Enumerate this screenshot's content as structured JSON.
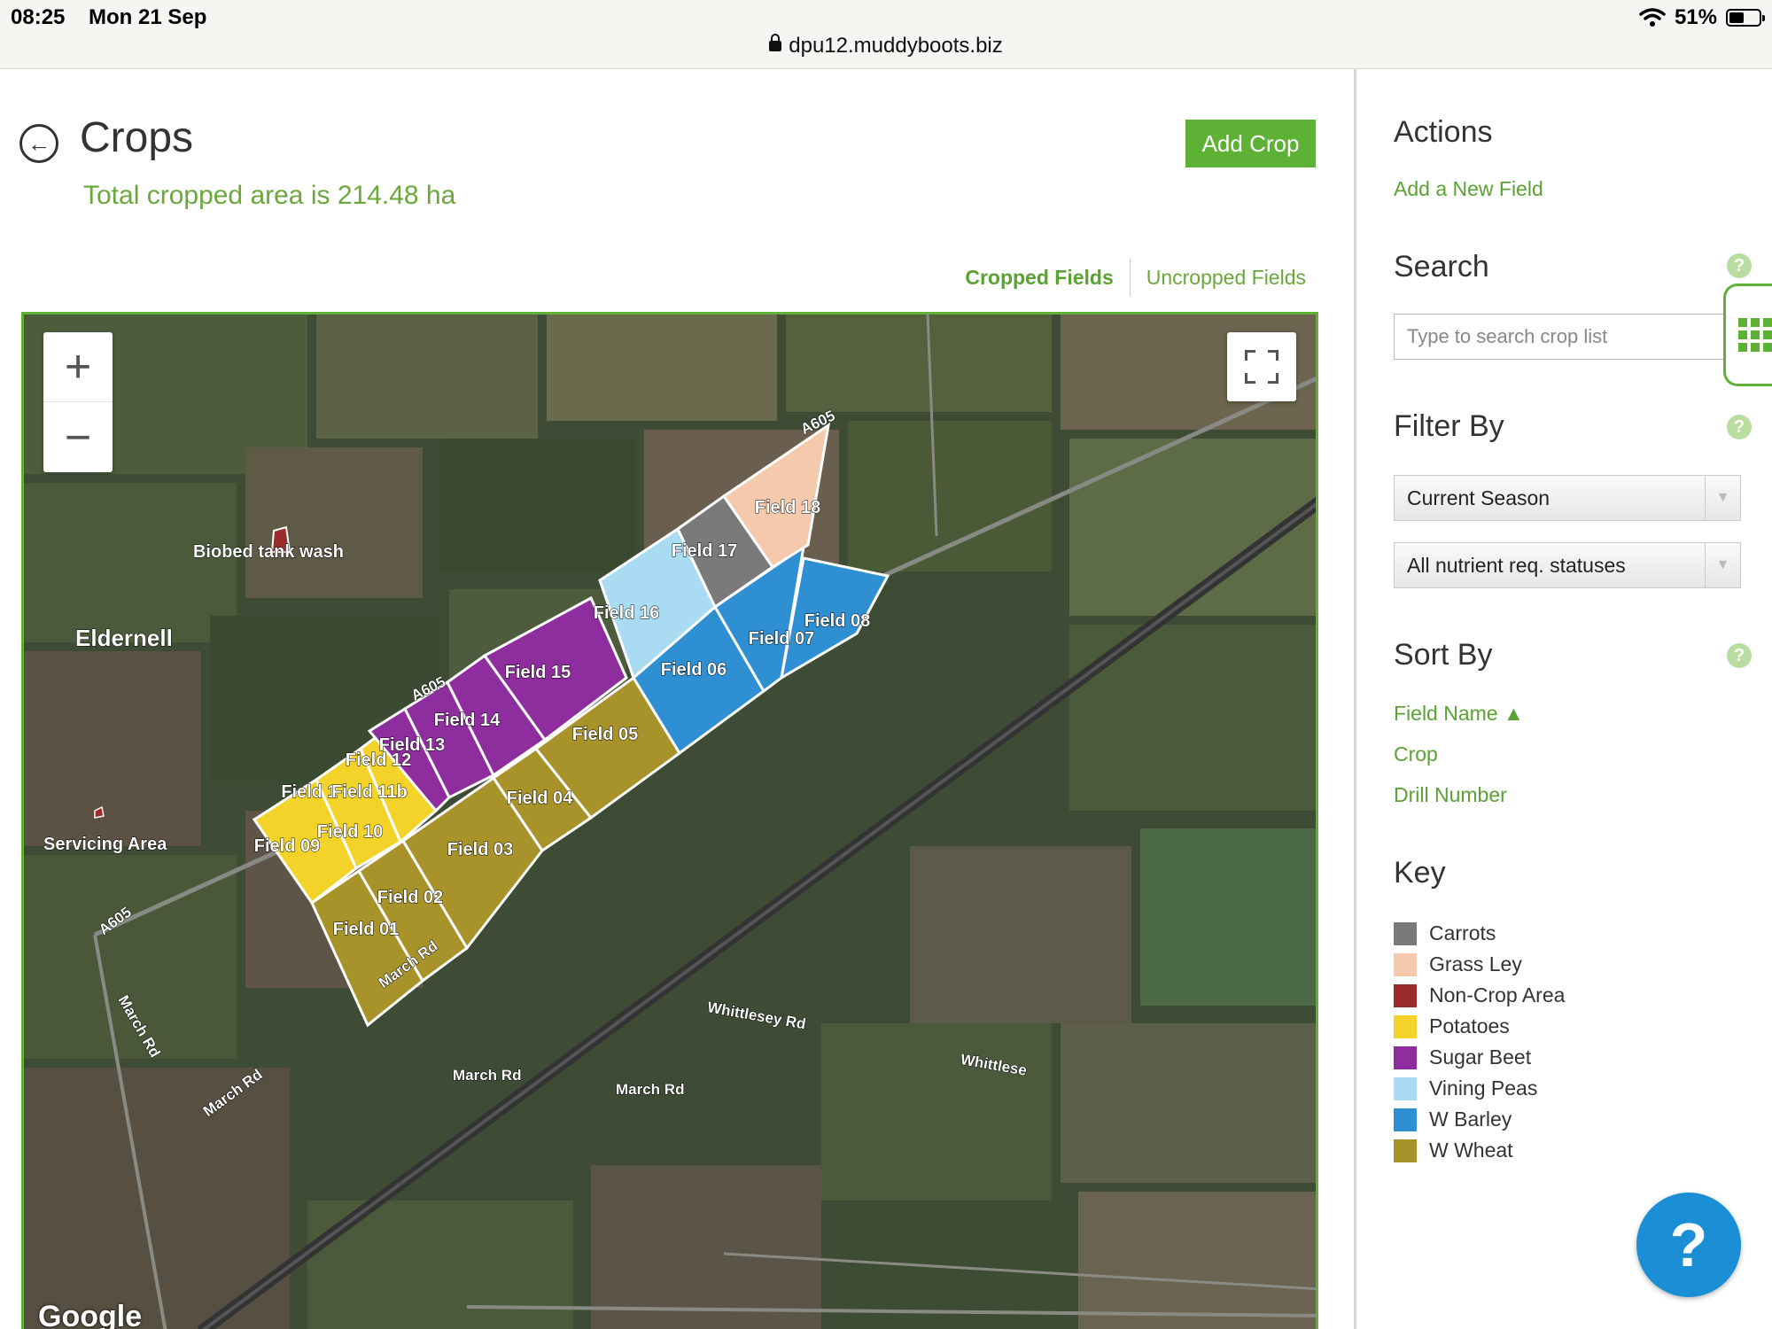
{
  "status": {
    "time": "08:25",
    "date": "Mon 21 Sep",
    "url": "dpu12.muddyboots.biz",
    "battery": "51%",
    "battery_level": 0.51
  },
  "header": {
    "title": "Crops",
    "total_text": "Total cropped area is 214.48 ha",
    "add_crop_label": "Add Crop"
  },
  "tabs": [
    {
      "label": "Cropped Fields",
      "active": true
    },
    {
      "label": "Uncropped Fields",
      "active": false
    }
  ],
  "map": {
    "zoom_in": "+",
    "zoom_out": "−",
    "attribution": "Google",
    "labels": {
      "place": "Eldernell",
      "biobed": "Biobed tank wash",
      "servicing": "Servicing Area",
      "road_a605_1": "A605",
      "road_a605_2": "A605",
      "road_a605_3": "A605",
      "road_march_1": "March Rd",
      "road_march_2": "March Rd",
      "road_march_3": "March Rd",
      "road_march_4": "March Rd",
      "road_march_5": "March Rd",
      "road_whittlesey_1": "Whittlesey Rd",
      "road_whittlesey_2": "Whittlese"
    },
    "fields": [
      {
        "name": "Field 01",
        "crop": "W Wheat"
      },
      {
        "name": "Field 02",
        "crop": "W Wheat"
      },
      {
        "name": "Field 03",
        "crop": "W Wheat"
      },
      {
        "name": "Field 04",
        "crop": "W Wheat"
      },
      {
        "name": "Field 05",
        "crop": "W Wheat"
      },
      {
        "name": "Field 06",
        "crop": "W Barley"
      },
      {
        "name": "Field 07",
        "crop": "W Barley"
      },
      {
        "name": "Field 08",
        "crop": "W Barley"
      },
      {
        "name": "Field 09",
        "crop": "Potatoes"
      },
      {
        "name": "Field 10",
        "crop": "Potatoes"
      },
      {
        "name": "Field 1",
        "crop": "Potatoes"
      },
      {
        "name": "Field 11b",
        "crop": "Potatoes"
      },
      {
        "name": "Field 12",
        "crop": "Potatoes"
      },
      {
        "name": "Field 13",
        "crop": "Sugar Beet"
      },
      {
        "name": "Field 14",
        "crop": "Sugar Beet"
      },
      {
        "name": "Field 15",
        "crop": "Sugar Beet"
      },
      {
        "name": "Field 16",
        "crop": "Vining Peas"
      },
      {
        "name": "Field 17",
        "crop": "Carrots"
      },
      {
        "name": "Field 18",
        "crop": "Grass Ley"
      }
    ]
  },
  "sidebar": {
    "actions_title": "Actions",
    "add_field_link": "Add a New Field",
    "search_title": "Search",
    "search_placeholder": "Type to search crop list",
    "filter_title": "Filter By",
    "filter_season": "Current Season",
    "filter_status": "All nutrient req. statuses",
    "sort_title": "Sort By",
    "sort_options": [
      {
        "label": "Field Name",
        "active": true,
        "direction": "▲"
      },
      {
        "label": "Crop",
        "active": false
      },
      {
        "label": "Drill Number",
        "active": false
      }
    ],
    "key_title": "Key",
    "key": [
      {
        "label": "Carrots",
        "color": "#7a7a7a"
      },
      {
        "label": "Grass Ley",
        "color": "#f5c9ac"
      },
      {
        "label": "Non-Crop Area",
        "color": "#9c2b2b"
      },
      {
        "label": "Potatoes",
        "color": "#f3d32a"
      },
      {
        "label": "Sugar Beet",
        "color": "#8e2d9e"
      },
      {
        "label": "Vining Peas",
        "color": "#a9dcf3"
      },
      {
        "label": "W Barley",
        "color": "#2e8fd2"
      },
      {
        "label": "W Wheat",
        "color": "#a8922a"
      }
    ],
    "help_label": "?"
  },
  "colors": {
    "accent": "#5db235",
    "link": "#5aa234"
  }
}
